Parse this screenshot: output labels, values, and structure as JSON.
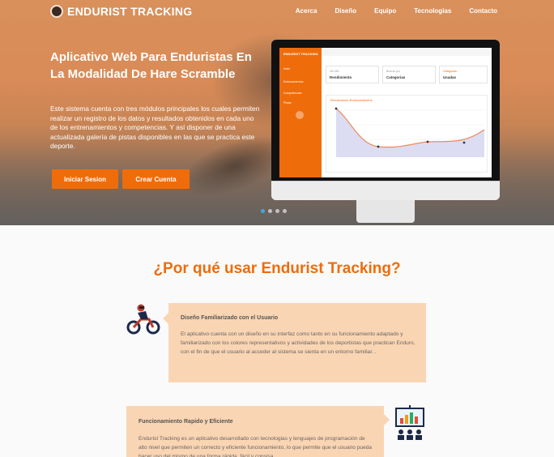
{
  "brand": {
    "name": "ENDURIST TRACKING"
  },
  "nav": {
    "items": [
      "Acerca",
      "Diseño",
      "Equipo",
      "Tecnologias",
      "Contacto"
    ]
  },
  "hero": {
    "title": "Aplicativo Web Para Enduristas En La Modalidad De Hare Scramble",
    "description": "Este sistema cuenta con tres módulos principales los cuales permiten realizar un registro de los datos y resultados obtenidos en cada uno de los entrenamientos y competencias. Y así disponer de una actualizada galería de pistas disponibles en las que se practica este deporte.",
    "login_label": "Iniciar Sesion",
    "register_label": "Crear Cuenta"
  },
  "mockup": {
    "brand": "ENDURIST TRACKING",
    "nav": [
      "Inicio",
      "Entrenamientos",
      "Competencias",
      "Pistas"
    ],
    "cards": [
      {
        "label": "Ver Mis",
        "value": "Rendimiento"
      },
      {
        "label": "Buscar por",
        "value": "Categorias"
      },
      {
        "label": "Categorias",
        "value": "Usadas"
      }
    ],
    "chart_title": "Rendimiento Entrenamientos"
  },
  "carousel": {
    "count": 4,
    "active": 0
  },
  "section": {
    "title": "¿Por qué usar Endurist Tracking?"
  },
  "features": [
    {
      "title": "Diseño Familiarizado con el Usuario",
      "text": "El aplicativo cuenta con un diseño en su interfaz como tanto en su funcionamiento adaptado y familiarizado con los colores representativos y actividades de los deportistas que practican Enduro, con el fin de que el usuario al acceder al sistema se sienta en un entorno familiar. ."
    },
    {
      "title": "Funcionamiento Rapido y Eficiente",
      "text": "Endurist Tracking es un aplicativo desarrollado con tecnologias y lenguajes de programación de alto nivel que permiten un correcto y eficiente funcionamiento, lo que permite que el usuario pueda hacer uso del mismo de una forma rápida, fácil y consisa."
    }
  ],
  "colors": {
    "accent": "#ef6c0a",
    "callout": "#fad5b3",
    "dot_active": "#4aa3df"
  }
}
